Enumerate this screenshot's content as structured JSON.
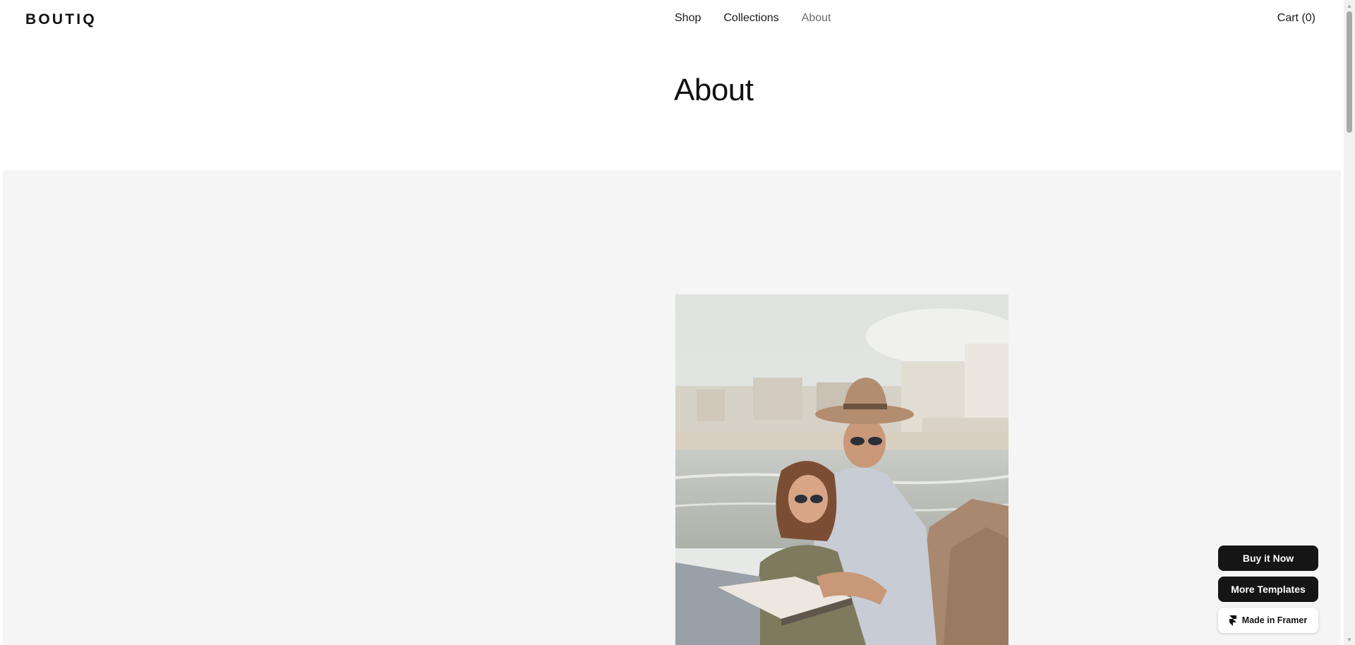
{
  "header": {
    "logo": "BOUTIQ",
    "nav": [
      {
        "label": "Shop"
      },
      {
        "label": "Collections"
      },
      {
        "label": "About"
      }
    ],
    "cart_label": "Cart (0)"
  },
  "main": {
    "title": "About",
    "photo_icon": "couple-beach-photo"
  },
  "floating": {
    "buy_label": "Buy it Now",
    "more_label": "More Templates",
    "framer_label": "Made in Framer",
    "framer_icon": "framer-logo-icon"
  },
  "colors": {
    "text": "#111111",
    "active_nav": "#6b6b6b",
    "section_bg": "#f4f5f4",
    "button_dark": "#151515"
  }
}
